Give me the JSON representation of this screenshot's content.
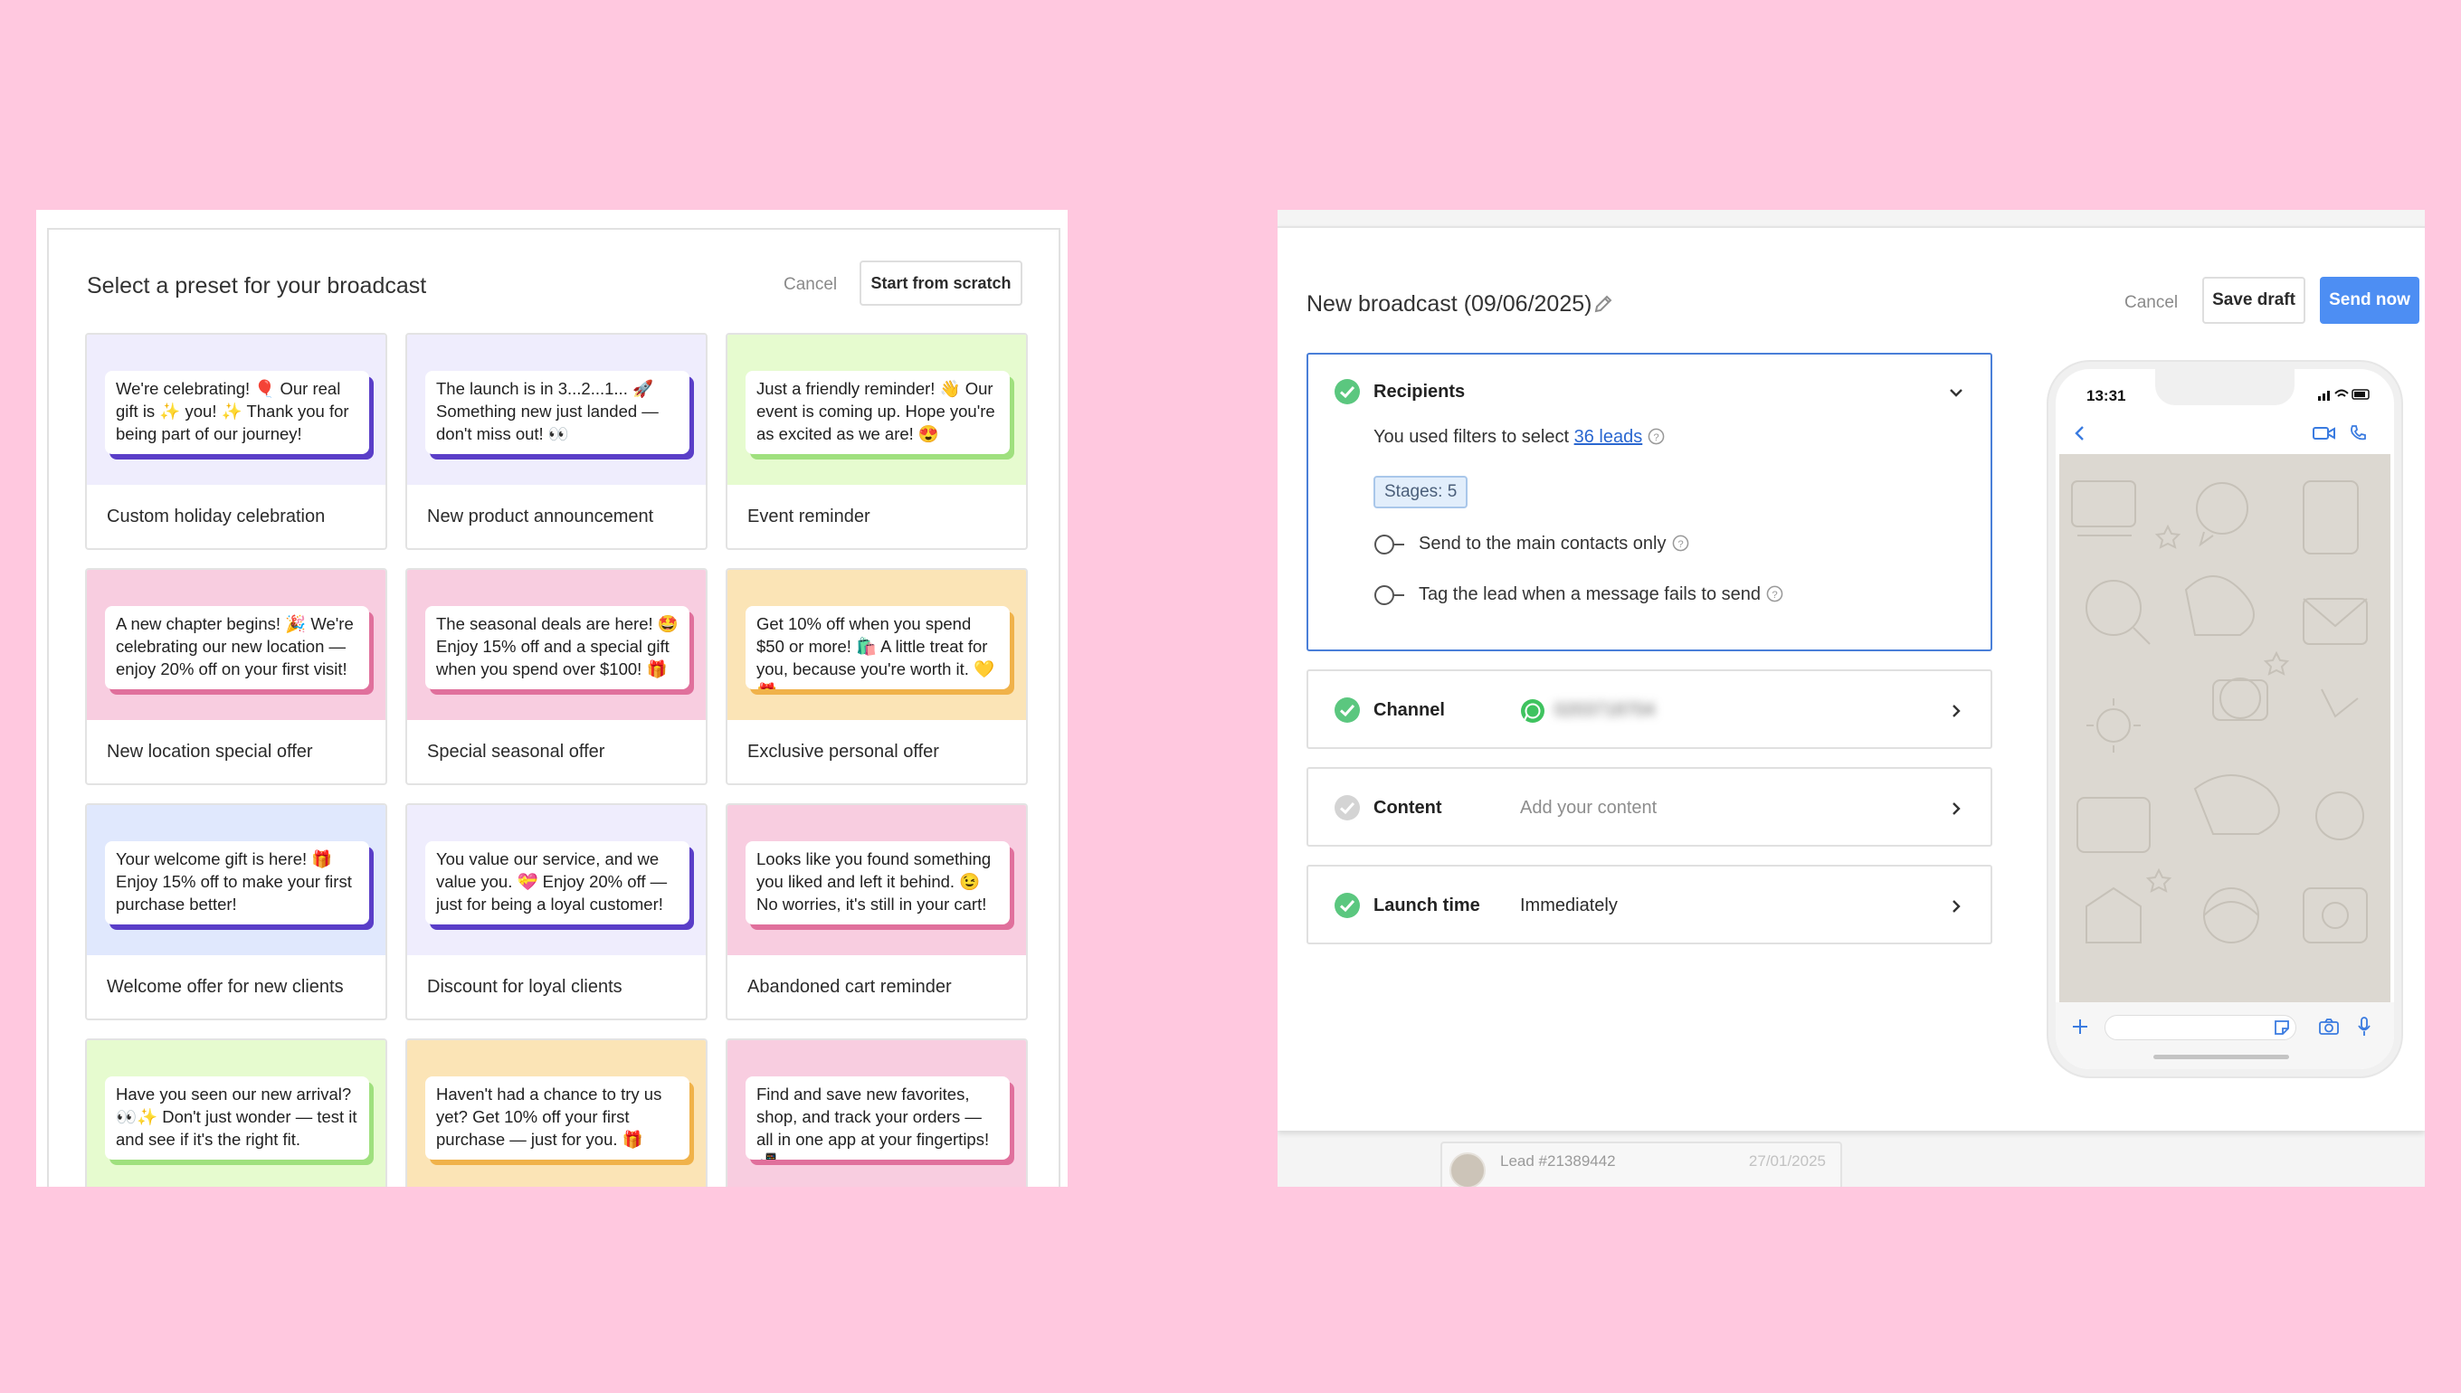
{
  "preset_modal": {
    "title": "Select a preset for your broadcast",
    "cancel_label": "Cancel",
    "start_label": "Start from scratch",
    "presets": [
      {
        "name": "Custom holiday celebration",
        "message": "We're celebrating! 🎈 Our real gift is ✨ you! ✨ Thank you for being part of our journey!",
        "bg": "#efedfd",
        "accent": "#5a3ec8"
      },
      {
        "name": "New product announcement",
        "message": "The launch is in 3...2...1... 🚀 Something new just landed — don't miss out! 👀",
        "bg": "#efedfd",
        "accent": "#5a3ec8"
      },
      {
        "name": "Event reminder",
        "message": "Just a friendly reminder! 👋 Our event is coming up. Hope you're as excited as we are! 😍",
        "bg": "#e6fbcf",
        "accent": "#9fe07e"
      },
      {
        "name": "New location special offer",
        "message": "A new chapter begins! 🎉 We're celebrating our new location — enjoy 20% off on your first visit!",
        "bg": "#f8cde0",
        "accent": "#e0709c"
      },
      {
        "name": "Special seasonal offer",
        "message": "The seasonal deals are here! 🤩 Enjoy 15% off and a special gift when you spend over $100! 🎁",
        "bg": "#f8cde0",
        "accent": "#e0709c"
      },
      {
        "name": "Exclusive personal offer",
        "message": "Get 10% off when you spend $50 or more! 🛍️ A little treat for you, because you're worth it. 💛 🎁",
        "bg": "#fbe4b6",
        "accent": "#f0b24a"
      },
      {
        "name": "Welcome offer for new clients",
        "message": "Your welcome gift is here! 🎁 Enjoy 15% off to make your first purchase better!",
        "bg": "#e0e8fd",
        "accent": "#5a3ec8"
      },
      {
        "name": "Discount for loyal clients",
        "message": "You value our service, and we value you. 💝 Enjoy 20% off — just for being a loyal customer!",
        "bg": "#efedfd",
        "accent": "#5a3ec8"
      },
      {
        "name": "Abandoned cart reminder",
        "message": "Looks like you found something you liked and left it behind. 😉 No worries, it's still in your cart!",
        "bg": "#f8cde0",
        "accent": "#e0709c"
      },
      {
        "name": "",
        "message": "Have you seen our new arrival? 👀✨ Don't just wonder — test it and see if it's the right fit.",
        "bg": "#e6fbcf",
        "accent": "#9fe07e"
      },
      {
        "name": "",
        "message": "Haven't had a chance to try us yet? Get 10% off your first purchase — just for you. 🎁",
        "bg": "#fbe4b6",
        "accent": "#f0b24a"
      },
      {
        "name": "",
        "message": "Find and save new favorites, shop, and track your orders — all in one app at your fingertips! 📲",
        "bg": "#f8cde0",
        "accent": "#e0709c"
      }
    ]
  },
  "broadcast": {
    "title": "New broadcast (09/06/2025)",
    "cancel_label": "Cancel",
    "save_label": "Save draft",
    "send_label": "Send now",
    "recipients": {
      "title": "Recipients",
      "filter_prefix": "You used filters to select ",
      "leads_link": "36 leads",
      "stage_tag": "Stages: 5",
      "option_main_contacts": "Send to the main contacts only",
      "option_tag_failed": "Tag the lead when a message fails to send"
    },
    "channel": {
      "title": "Channel",
      "value": "0203718704"
    },
    "content": {
      "title": "Content",
      "value": "Add your content"
    },
    "launch": {
      "title": "Launch time",
      "value": "Immediately"
    },
    "phone": {
      "time": "13:31"
    },
    "lead_behind": {
      "name": "Lead #21389442",
      "date": "27/01/2025"
    }
  },
  "colors": {
    "background": "#ffc8df",
    "primary_button": "#4d8ef3",
    "check_green": "#5bc77f",
    "check_gray": "#d4d4d4",
    "link": "#2a67d0"
  },
  "icons": [
    "pencil-icon",
    "check-circle-icon",
    "chevron-down-icon",
    "chevron-right-icon",
    "help-icon",
    "toggle-off-icon",
    "whatsapp-icon",
    "back-arrow-icon",
    "video-icon",
    "phone-icon",
    "plus-icon",
    "sticker-icon",
    "camera-icon",
    "mic-icon"
  ]
}
